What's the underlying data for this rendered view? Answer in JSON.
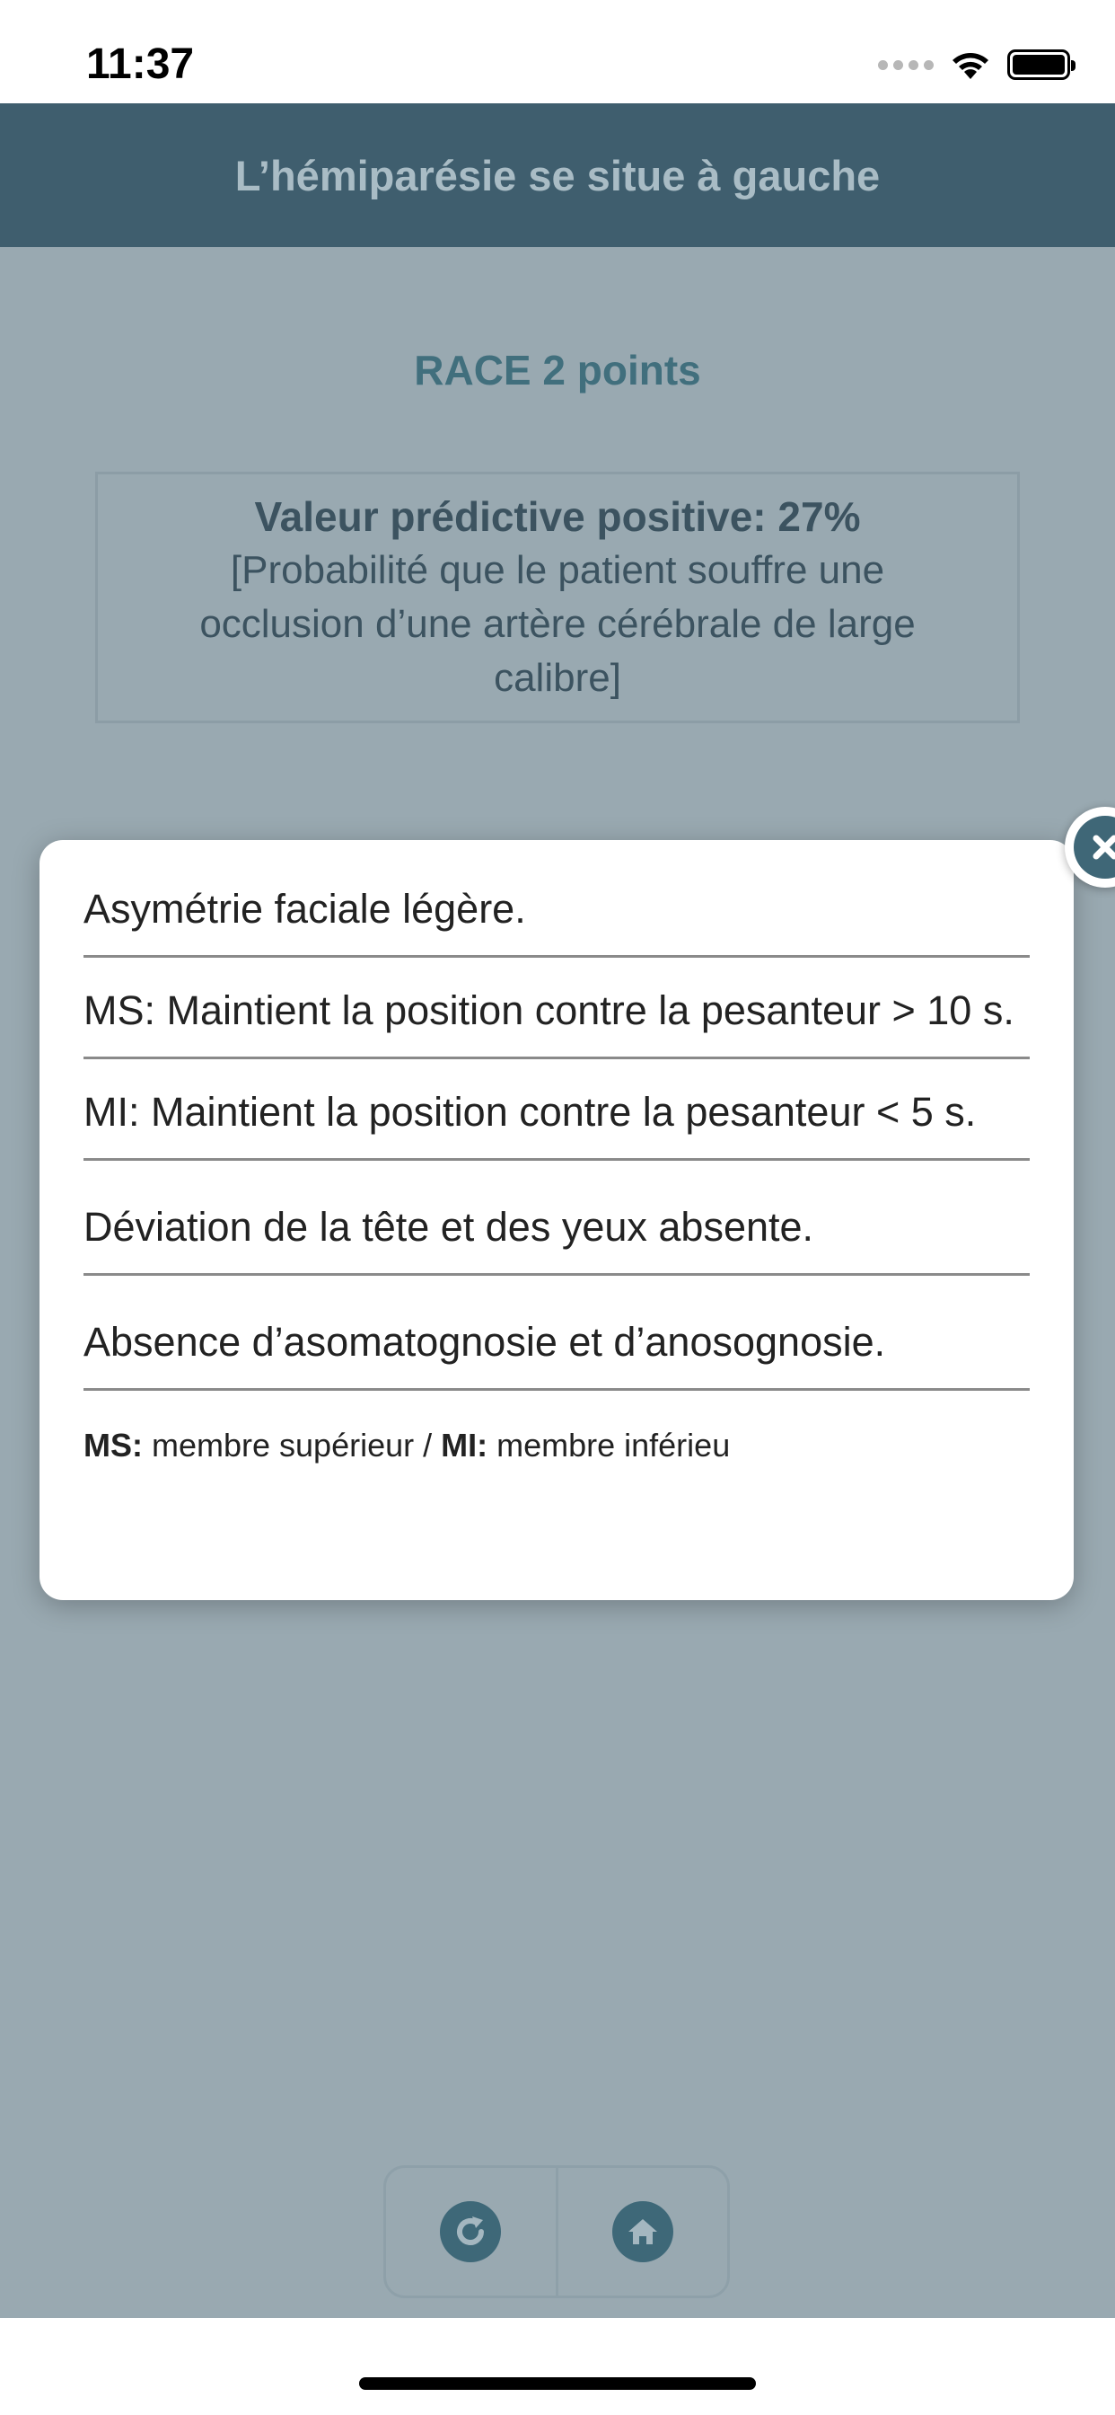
{
  "status_bar": {
    "time": "11:37"
  },
  "nav": {
    "title": "L’hémiparésie se situe à gauche"
  },
  "result": {
    "score_title": "RACE 2 points",
    "ppv_value": "Valeur prédictive positive: 27%",
    "ppv_desc": "[Probabilité que le patient souffre une occlusion d’une artère cérébrale de large calibre]"
  },
  "popup": {
    "items": [
      "Asymétrie faciale légère.",
      "MS: Maintient la position contre la pesanteur > 10 s.",
      "MI: Maintient la position contre la pesanteur < 5 s.",
      "Déviation de la tête et des yeux absente.",
      "Absence d’asomatognosie et d’anosognosie."
    ],
    "legend": {
      "ms_abbr": "MS:",
      "ms_text": " membre supérieur / ",
      "mi_abbr": "MI:",
      "mi_text": " membre inférieu"
    }
  },
  "icons": {
    "close": "close-icon",
    "refresh": "refresh-icon",
    "home": "home-icon",
    "wifi": "wifi-icon",
    "battery": "battery-icon"
  },
  "colors": {
    "nav_bg": "#3f5e6e",
    "content_bg": "#99a9b1",
    "accent": "#3f6777"
  }
}
